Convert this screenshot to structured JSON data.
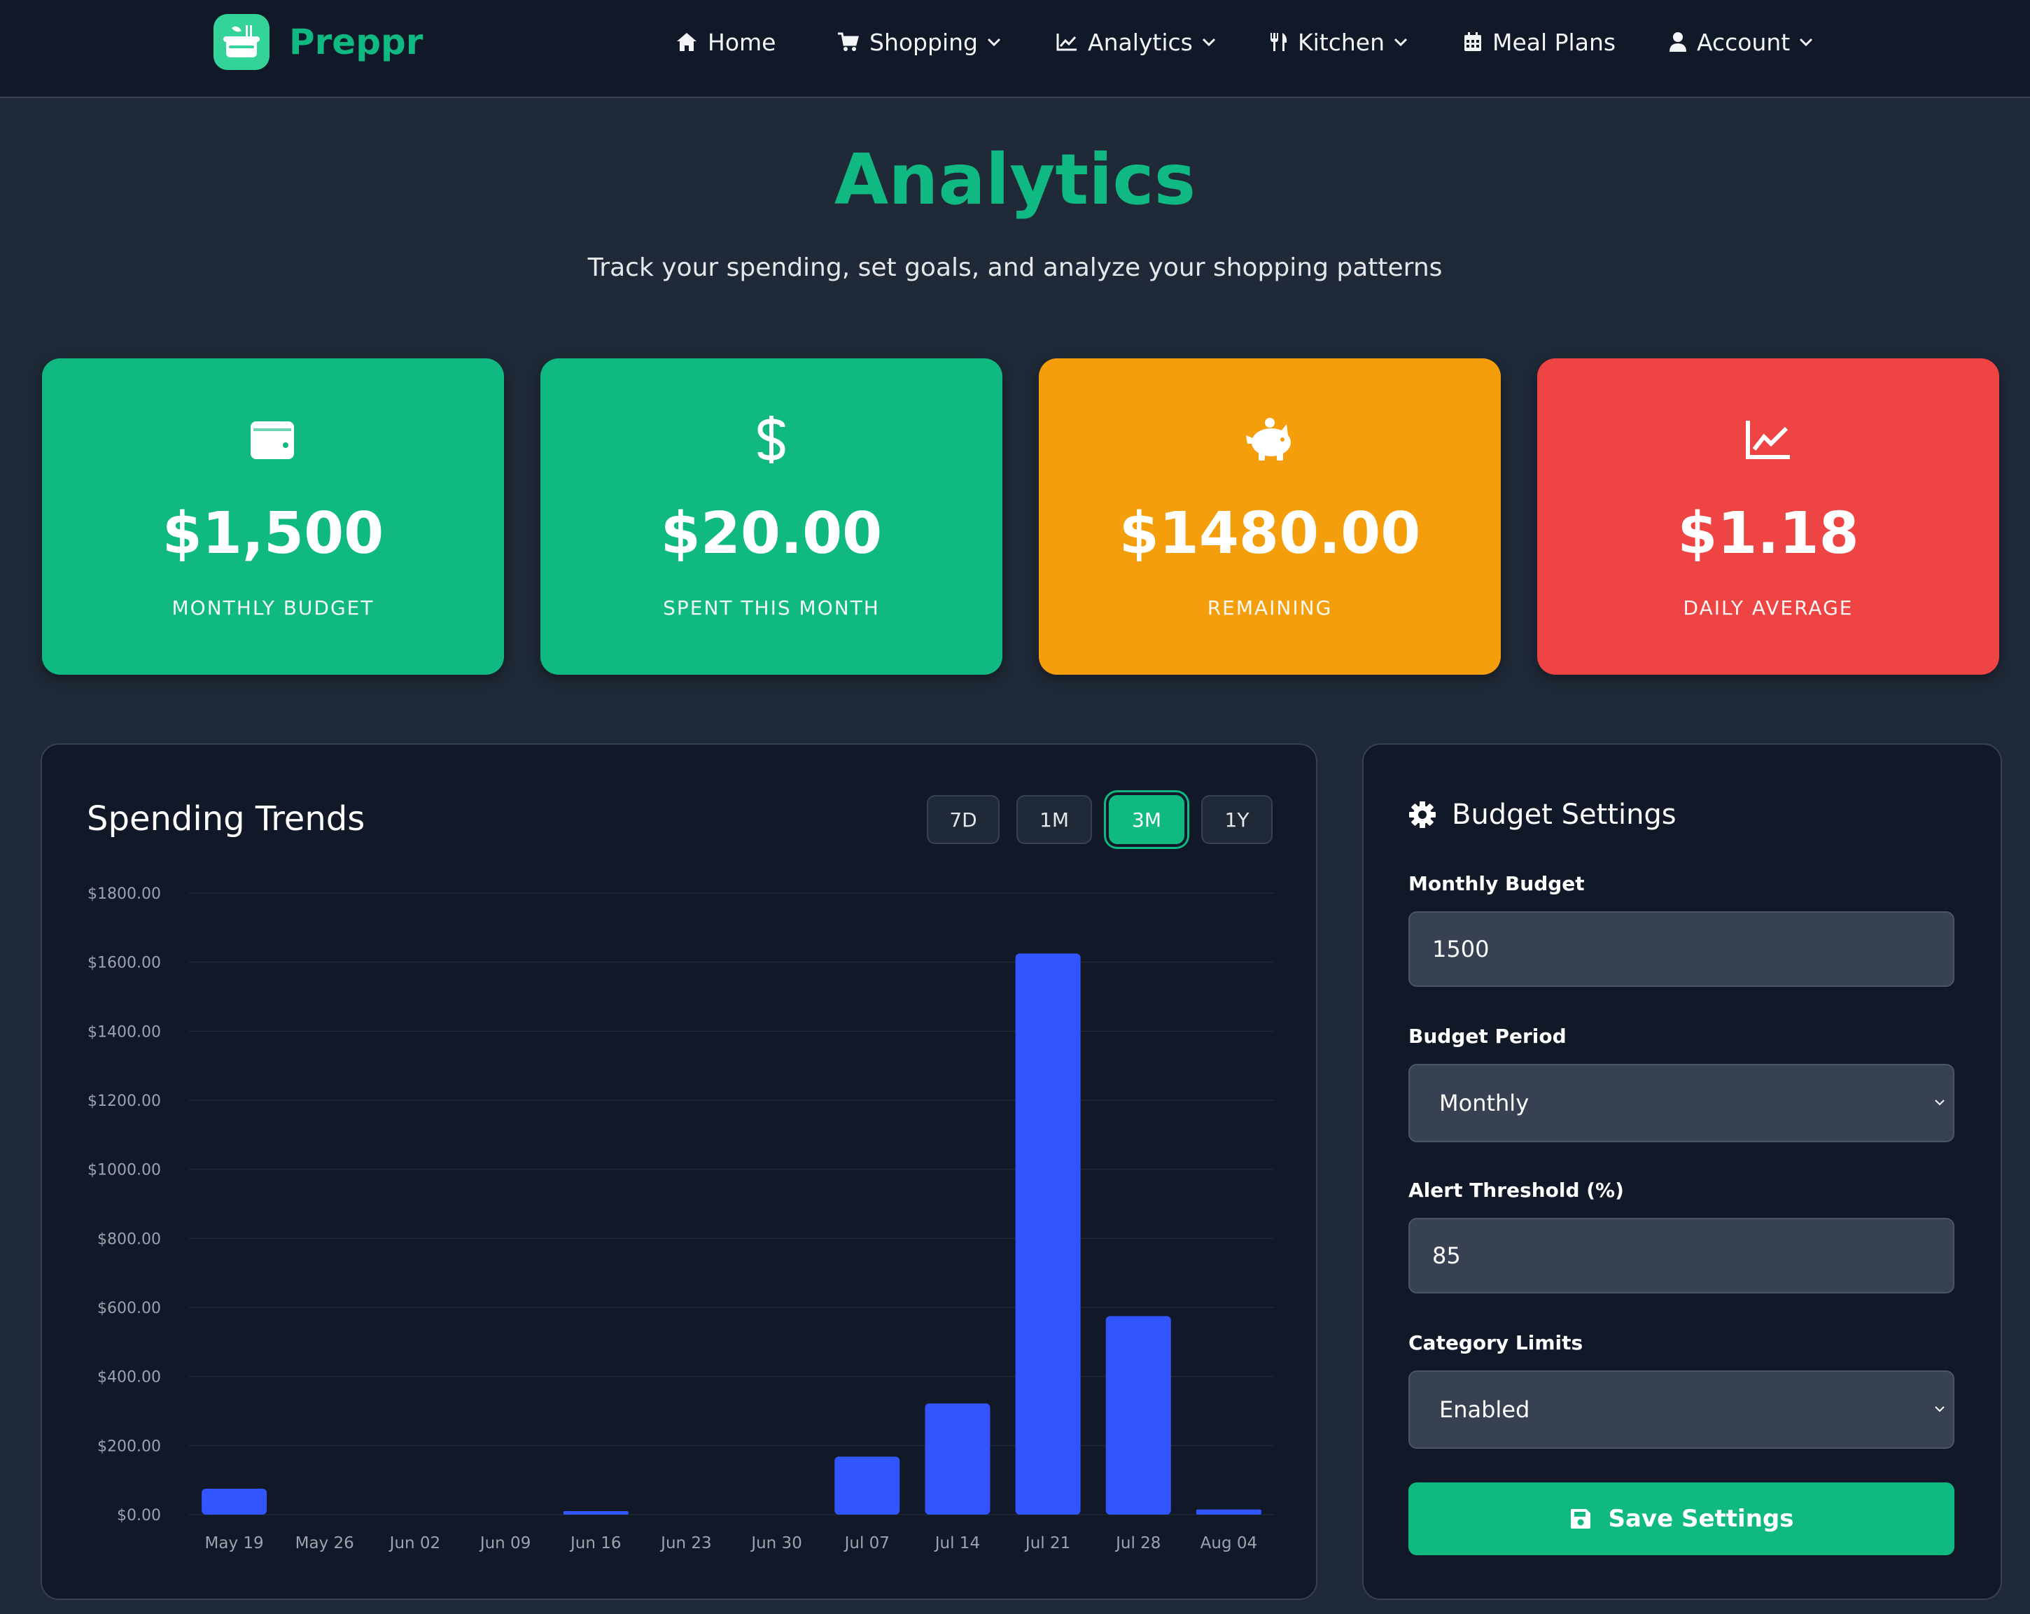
{
  "brand": {
    "name": "Preppr"
  },
  "nav": {
    "home": "Home",
    "shopping": "Shopping",
    "analytics": "Analytics",
    "kitchen": "Kitchen",
    "meal_plans": "Meal Plans",
    "account": "Account"
  },
  "header": {
    "title": "Analytics",
    "subtitle": "Track your spending, set goals, and analyze your shopping patterns"
  },
  "stats": [
    {
      "icon": "wallet-icon",
      "value": "$1,500",
      "label": "MONTHLY BUDGET",
      "color": "#10b981"
    },
    {
      "icon": "dollar-icon",
      "value": "$20.00",
      "label": "SPENT THIS MONTH",
      "color": "#10b981"
    },
    {
      "icon": "piggy-bank-icon",
      "value": "$1480.00",
      "label": "REMAINING",
      "color": "#f59e0b"
    },
    {
      "icon": "chart-line-icon",
      "value": "$1.18",
      "label": "DAILY AVERAGE",
      "color": "#ef4444"
    }
  ],
  "trends": {
    "title": "Spending Trends",
    "ranges": [
      "7D",
      "1M",
      "3M",
      "1Y"
    ],
    "active_range": "3M"
  },
  "chart_data": {
    "type": "bar",
    "title": "",
    "xlabel": "",
    "ylabel": "",
    "categories": [
      "May 19",
      "May 26",
      "Jun 02",
      "Jun 09",
      "Jun 16",
      "Jun 23",
      "Jun 30",
      "Jul 07",
      "Jul 14",
      "Jul 21",
      "Jul 28",
      "Aug 04"
    ],
    "values": [
      75,
      0,
      0,
      0,
      8,
      0,
      0,
      168,
      322,
      1625,
      575,
      15
    ],
    "ylim": [
      0,
      1800
    ],
    "yticks": [
      "$0.00",
      "$200.00",
      "$400.00",
      "$600.00",
      "$800.00",
      "$1000.00",
      "$1200.00",
      "$1400.00",
      "$1600.00",
      "$1800.00"
    ],
    "bar_color": "#3355ff",
    "grid": true
  },
  "settings": {
    "title": "Budget Settings",
    "monthly_budget_label": "Monthly Budget",
    "monthly_budget_value": "1500",
    "budget_period_label": "Budget Period",
    "budget_period_value": "Monthly",
    "alert_threshold_label": "Alert Threshold (%)",
    "alert_threshold_value": "85",
    "category_limits_label": "Category Limits",
    "category_limits_value": "Enabled",
    "save_label": "Save Settings"
  },
  "colors": {
    "accent": "#10b981",
    "background": "#1f2937",
    "panel": "#111827",
    "warning": "#f59e0b",
    "danger": "#ef4444",
    "bar": "#3355ff"
  }
}
